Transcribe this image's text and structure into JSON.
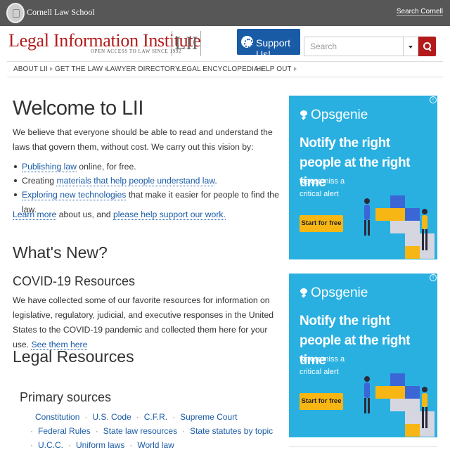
{
  "topbar": {
    "school": "Cornell Law School",
    "search_link": "Search Cornell"
  },
  "logo": {
    "title": "Legal Information Institute",
    "tagline": "OPEN ACCESS TO LAW SINCE 1992",
    "mark": "LII"
  },
  "support": {
    "label": "Support Us!"
  },
  "search": {
    "placeholder": "Search"
  },
  "nav": [
    "ABOUT LII",
    "GET THE LAW",
    "LAWYER DIRECTORY",
    "LEGAL ENCYCLOPEDIA",
    "HELP OUT"
  ],
  "welcome": {
    "title": "Welcome to LII",
    "intro": "We believe that everyone should be able to read and understand the laws that govern them, without cost. We carry out this vision by:",
    "bullets": [
      {
        "link": "Publishing law",
        "rest": " online, for free."
      },
      {
        "pre": "Creating ",
        "link": "materials that help people understand law",
        "rest": "."
      },
      {
        "link": "Exploring new technologies",
        "rest": " that make it easier for people to find the law."
      }
    ],
    "learn_link": "Learn more",
    "learn_mid": " about us, and ",
    "support_link": "please help support our work."
  },
  "whats_new": {
    "title": "What's New?",
    "covid_title": "COVID-19 Resources",
    "covid_text": "We have collected some of our favorite resources for information on legislative, regulatory, judicial, and executive responses in the United States to the COVID-19 pandemic and collected them here for your use. ",
    "covid_link": "See them here"
  },
  "legal": {
    "title": "Legal Resources",
    "primary_title": "Primary sources",
    "row1": [
      "Constitution",
      "U.S. Code",
      "C.F.R.",
      "Supreme Court"
    ],
    "row2": [
      "Federal Rules",
      "State law resources",
      "State statutes by topic"
    ],
    "row3": [
      "U.C.C.",
      "Uniform laws",
      "World law"
    ],
    "separator": "·"
  },
  "ads": [
    {
      "brand": "Opsgenie",
      "headline": "Notify the right people at the right time",
      "sub": "Never miss a critical alert",
      "cta": "Start for free",
      "corner": "i"
    },
    {
      "brand": "Opsgenie",
      "headline": "Notify the right people at the right time",
      "sub": "Never miss a critical alert",
      "cta": "Start for free",
      "corner": "i"
    }
  ],
  "colors": {
    "brand_red": "#b31b1b",
    "link_blue": "#1a5ba6",
    "ad_blue": "#29b0e1",
    "ad_yellow": "#f7b614",
    "topbar": "#575757"
  }
}
